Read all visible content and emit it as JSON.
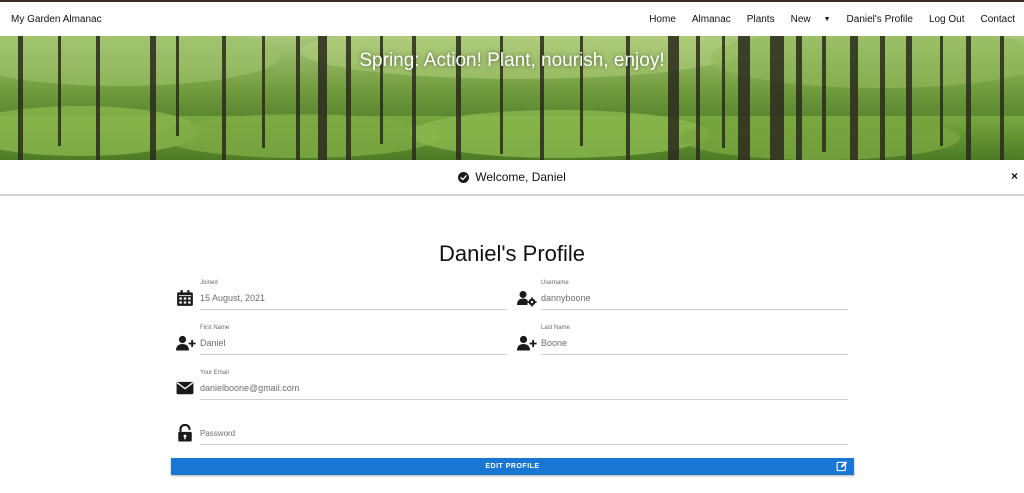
{
  "nav": {
    "brand": "My Garden Almanac",
    "items": [
      {
        "label": "Home"
      },
      {
        "label": "Almanac"
      },
      {
        "label": "Plants"
      },
      {
        "label": "New"
      },
      {
        "label": "Daniel's Profile"
      },
      {
        "label": "Log Out"
      },
      {
        "label": "Contact"
      }
    ]
  },
  "hero": {
    "title": "Spring: Action! Plant, nourish, enjoy!"
  },
  "alert": {
    "message": "Welcome, Daniel",
    "close": "×"
  },
  "profile": {
    "title": "Daniel's Profile",
    "joined": {
      "label": "Joined",
      "value": "15 August, 2021"
    },
    "username": {
      "label": "Username",
      "value": "dannyboone"
    },
    "first_name": {
      "label": "First Name",
      "value": "Daniel"
    },
    "last_name": {
      "label": "Last Name",
      "value": "Boone"
    },
    "email": {
      "label": "Your Email",
      "value": "danielboone@gmail.com"
    },
    "password": {
      "label": "Password",
      "value": ""
    },
    "edit_button": "EDIT PROFILE"
  },
  "colors": {
    "primary_button": "#1976d2",
    "hero_green": "#4f7a2a"
  }
}
